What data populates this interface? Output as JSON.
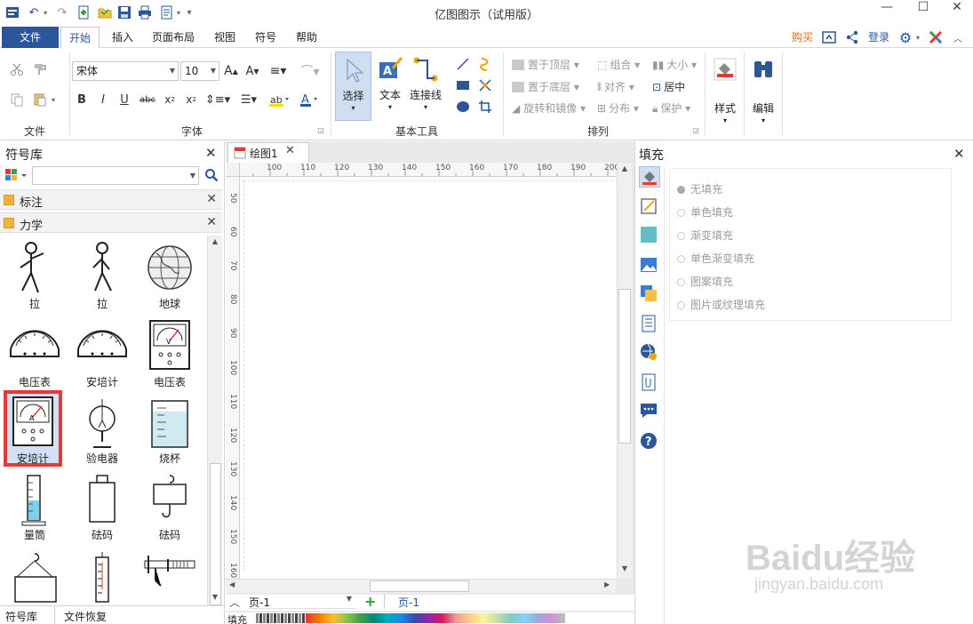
{
  "window": {
    "title": "亿图图示（试用版）",
    "minimize": "—",
    "maximize": "☐",
    "close": "✕"
  },
  "menu": {
    "file": "文件",
    "tabs": [
      "开始",
      "插入",
      "页面布局",
      "视图",
      "符号",
      "帮助"
    ],
    "right": {
      "buy": "购买",
      "login": "登录"
    }
  },
  "ribbon": {
    "groups": {
      "file": "文件",
      "font": "字体",
      "basic_tools": "基本工具",
      "arrange": "排列"
    },
    "font_name": "宋体",
    "font_size": "10",
    "tools": {
      "select": "选择",
      "text": "文本",
      "connector": "连接线"
    },
    "arrange": {
      "bring_front": "置于顶层",
      "send_back": "置于底层",
      "rotate_mirror": "旋转和镜像",
      "group": "组合",
      "align": "对齐",
      "distribute": "分布",
      "size": "大小",
      "center": "居中",
      "protect": "保护"
    },
    "style": "样式",
    "edit": "编辑"
  },
  "library": {
    "title": "符号库",
    "categories": [
      "标注",
      "力学"
    ],
    "symbols": [
      "拉",
      "拉",
      "地球",
      "电压表",
      "安培计",
      "电压表",
      "安培计",
      "验电器",
      "烧杯",
      "量筒",
      "砝码",
      "砝码"
    ],
    "bottom_tabs": [
      "符号库",
      "文件恢复"
    ]
  },
  "document": {
    "tab": "绘图1",
    "ruler_h": [
      "100",
      "110",
      "120",
      "130",
      "140",
      "150",
      "160",
      "170",
      "180",
      "190",
      "200"
    ],
    "ruler_v": [
      "50",
      "60",
      "70",
      "80",
      "90",
      "100",
      "110",
      "120",
      "130",
      "140",
      "150",
      "160"
    ],
    "page_select": "页-1",
    "page_tab": "页-1",
    "fill_label": "填充"
  },
  "fill_panel": {
    "title": "填充",
    "options": [
      "无填充",
      "单色填充",
      "渐变填充",
      "单色渐变填充",
      "图案填充",
      "图片或纹理填充"
    ],
    "selected_index": 0
  },
  "watermark": {
    "text": "Baidu经验",
    "sub": "jingyan.baidu.com"
  },
  "colors": {
    "accent": "#2b579a",
    "highlight": "#e53935",
    "buy": "#e36c09"
  }
}
